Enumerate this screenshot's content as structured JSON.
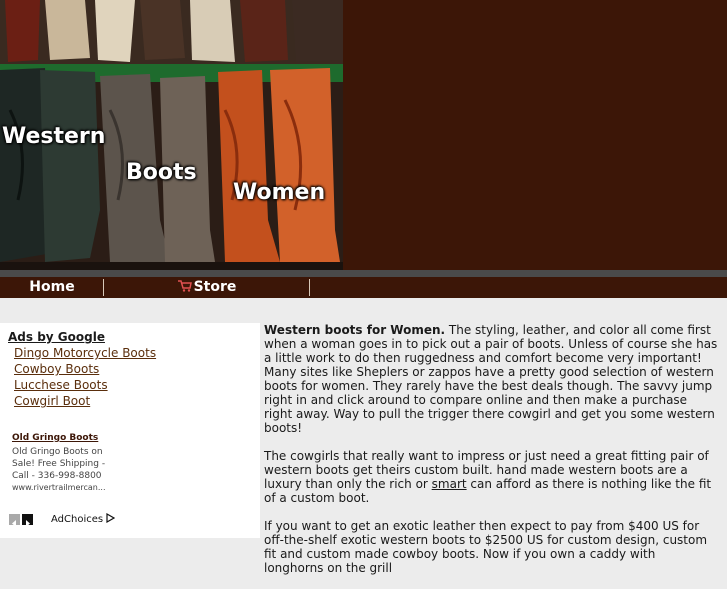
{
  "header": {
    "hero_words": [
      "Western",
      "Boots",
      "Women"
    ]
  },
  "nav": {
    "items": [
      {
        "label": "Home",
        "icon": null
      },
      {
        "label": "Store",
        "icon": "shopping-cart-icon"
      }
    ]
  },
  "sidebar": {
    "ads_title": "Ads by Google",
    "ad_links": [
      "Dingo Motorcycle Boots",
      "Cowboy Boots",
      "Lucchese Boots",
      "Cowgirl Boot"
    ],
    "featured_ad": {
      "title": "Old Gringo Boots",
      "lines": [
        "Old Gringo Boots on",
        "Sale! Free Shipping -",
        "Call - 336-998-8800",
        "www.rivertrailmercan..."
      ]
    },
    "adchoices_label": "AdChoices"
  },
  "article": {
    "lead": "Western boots for Women.",
    "p1_rest": " The styling, leather, and color all come first when a woman goes in to pick out a pair of boots. Unless of course she has a little work to do then ruggedness and comfort become very important!",
    "p1_line2": "Many sites like Sheplers or zappos have a pretty good selection of western boots for women. They rarely have the best deals though. The savvy jump right in and click around to compare online and then make a purchase right away. Way to pull the trigger there cowgirl and get you some western boots!",
    "p2_a": "The cowgirls that really want to impress or just need a great fitting pair of western boots get theirs custom built. hand made western boots are a luxury than only the rich or ",
    "p2_link": "smart",
    "p2_b": " can afford as there is nothing like the fit of a custom boot.",
    "p3": "If you want to get an exotic leather then expect to pay from $400 US for off-the-shelf exotic western boots to $2500 US for custom design, custom fit and custom made cowboy boots. Now if you own a caddy with longhorns on the grill"
  },
  "colors": {
    "header_bg": "#3c1607",
    "band": "#4a4a4a",
    "page_bg": "#ececec",
    "link": "#5a2e0c"
  }
}
